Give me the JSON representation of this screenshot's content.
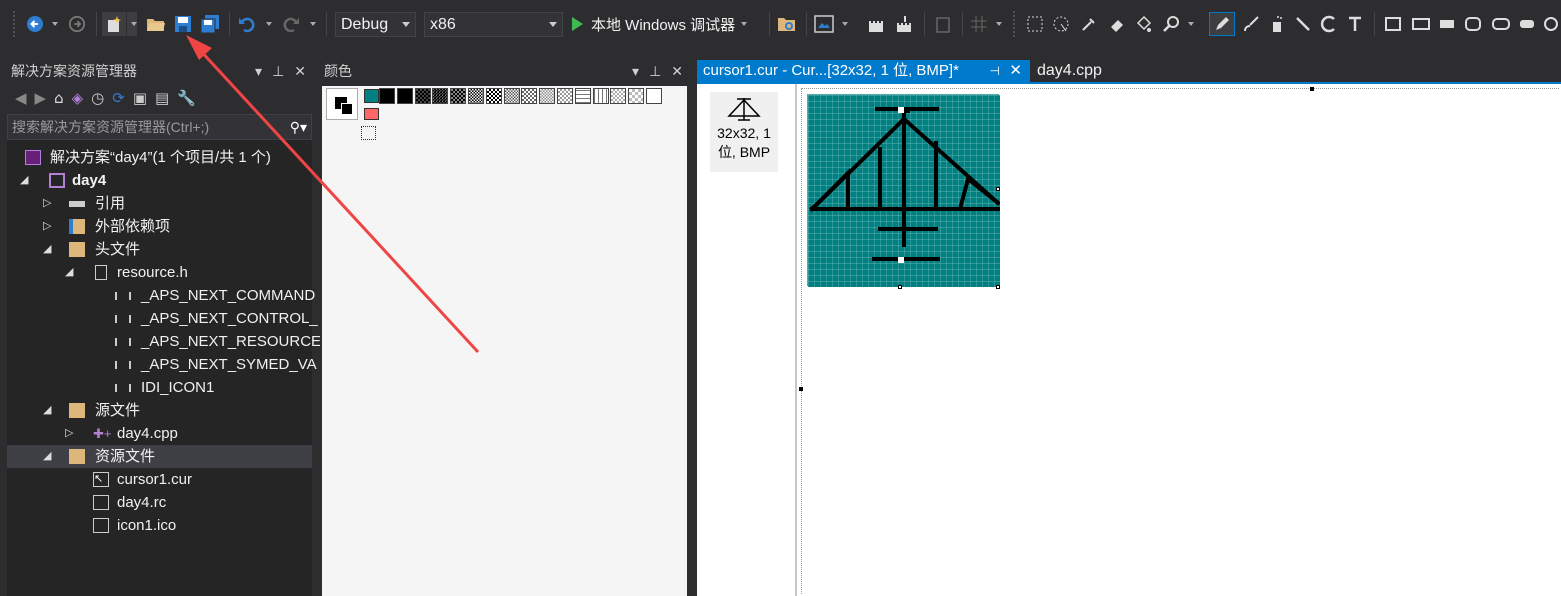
{
  "toolbar": {
    "config_value": "Debug",
    "platform_value": "x86",
    "start_debugger_label": "本地 Windows 调试器",
    "icons": [
      "back-icon",
      "forward-icon",
      "new-project-icon",
      "open-folder-icon",
      "save-icon",
      "save-all-icon",
      "undo-icon",
      "redo-icon",
      "play-icon",
      "folder-find-icon"
    ]
  },
  "solution_explorer": {
    "title": "解决方案资源管理器",
    "search_placeholder": "搜索解决方案资源管理器(Ctrl+;)",
    "items": [
      {
        "label": "解决方案“day4”(1 个项目/共 1 个)"
      },
      {
        "label": "day4"
      },
      {
        "label": "引用"
      },
      {
        "label": "外部依赖项"
      },
      {
        "label": "头文件"
      },
      {
        "label": "resource.h"
      },
      {
        "label": "_APS_NEXT_COMMAND"
      },
      {
        "label": "_APS_NEXT_CONTROL_"
      },
      {
        "label": "_APS_NEXT_RESOURCE_"
      },
      {
        "label": "_APS_NEXT_SYMED_VA"
      },
      {
        "label": "IDI_ICON1"
      },
      {
        "label": "源文件"
      },
      {
        "label": "day4.cpp"
      },
      {
        "label": "资源文件"
      },
      {
        "label": "cursor1.cur"
      },
      {
        "label": "day4.rc"
      },
      {
        "label": "icon1.ico"
      }
    ]
  },
  "colors_panel": {
    "title": "颜色"
  },
  "editor": {
    "active_tab": "cursor1.cur - Cur...[32x32, 1 位, BMP]*",
    "other_tab": "day4.cpp",
    "image_item_line1": "32x32, 1",
    "image_item_line2": "位, BMP"
  },
  "colors": {
    "accent": "#007acc",
    "canvas_fill": "#008080",
    "arrow": "#ff3b3b"
  }
}
